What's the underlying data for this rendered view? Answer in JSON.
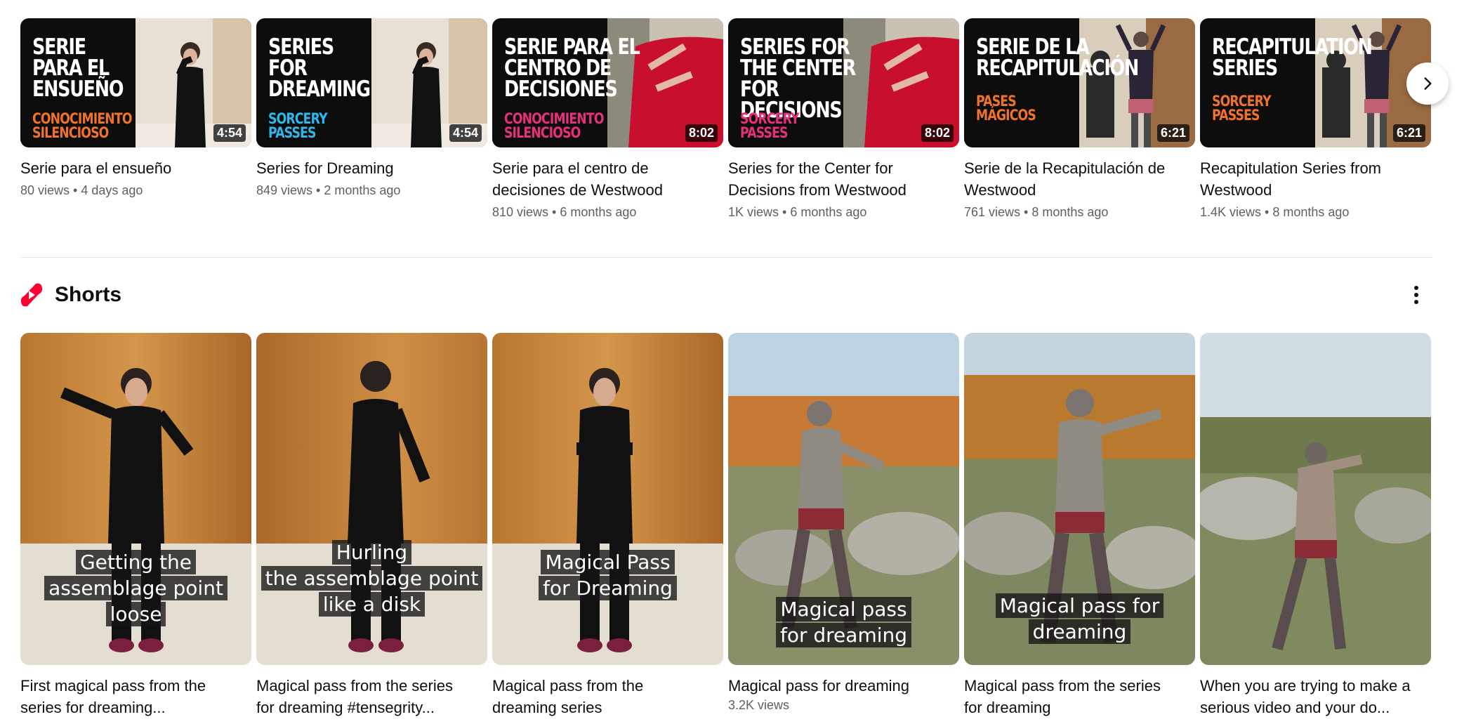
{
  "videos": [
    {
      "art_title": "SERIE\nPARA EL\nENSUEÑO",
      "art_subtitle": "CONOCIMIENTO\nSILENCIOSO",
      "art_color": "#f0722b",
      "duration": "4:54",
      "title": "Serie para el ensueño",
      "views": "80 views",
      "age": "4 days ago"
    },
    {
      "art_title": "SERIES\nFOR\nDREAMING",
      "art_subtitle": "SORCERY\nPASSES",
      "art_color": "#2fb6ea",
      "duration": "4:54",
      "title": "Series for Dreaming",
      "views": "849 views",
      "age": "2 months ago"
    },
    {
      "art_title": "SERIE PARA EL\nCENTRO DE\nDECISIONES",
      "art_subtitle": "CONOCIMIENTO\nSILENCIOSO",
      "art_color": "#e5307a",
      "duration": "8:02",
      "title": "Serie para el centro de decisiones de Westwood",
      "views": "810 views",
      "age": "6 months ago"
    },
    {
      "art_title": "SERIES FOR\nTHE CENTER FOR\nDECISIONS",
      "art_subtitle": "SORCERY\nPASSES",
      "art_color": "#e5307a",
      "duration": "8:02",
      "title": "Series for the Center for Decisions from Westwood",
      "views": "1K views",
      "age": "6 months ago"
    },
    {
      "art_title": "SERIE DE LA\nRECAPITULACIÓN",
      "art_subtitle": "PASES\nMÁGICOS",
      "art_color": "#f0722b",
      "duration": "6:21",
      "title": "Serie de la Recapitulación de Westwood",
      "views": "761 views",
      "age": "8 months ago"
    },
    {
      "art_title": "RECAPITULATION\nSERIES",
      "art_subtitle": "SORCERY\nPASSES",
      "art_color": "#f0722b",
      "duration": "6:21",
      "title": "Recapitulation Series from Westwood",
      "views": "1.4K views",
      "age": "8 months ago"
    }
  ],
  "next_icon": "chevron-right-icon",
  "shorts": {
    "section_title": "Shorts",
    "logo_icon": "shorts-logo-icon",
    "more_icon": "more-vertical-icon",
    "brand_color": "#ff0033",
    "items": [
      {
        "caption": "Getting the\nassemblage point\nloose",
        "title": "First magical pass from the series for dreaming...",
        "views": ""
      },
      {
        "caption": "Hurling\nthe assemblage point\nlike a disk",
        "title": "Magical pass from the series for dreaming #tensegrity...",
        "views": ""
      },
      {
        "caption": "Magical Pass\nfor Dreaming",
        "title": "Magical pass from the dreaming series",
        "views": ""
      },
      {
        "caption": "Magical pass\nfor dreaming",
        "title": "Magical pass for dreaming",
        "views": "3.2K views"
      },
      {
        "caption": "Magical pass for\ndreaming",
        "title": "Magical pass from the series for dreaming",
        "views": ""
      },
      {
        "caption": "",
        "title": "When you are trying to make a serious video and your do...",
        "views": ""
      }
    ]
  }
}
